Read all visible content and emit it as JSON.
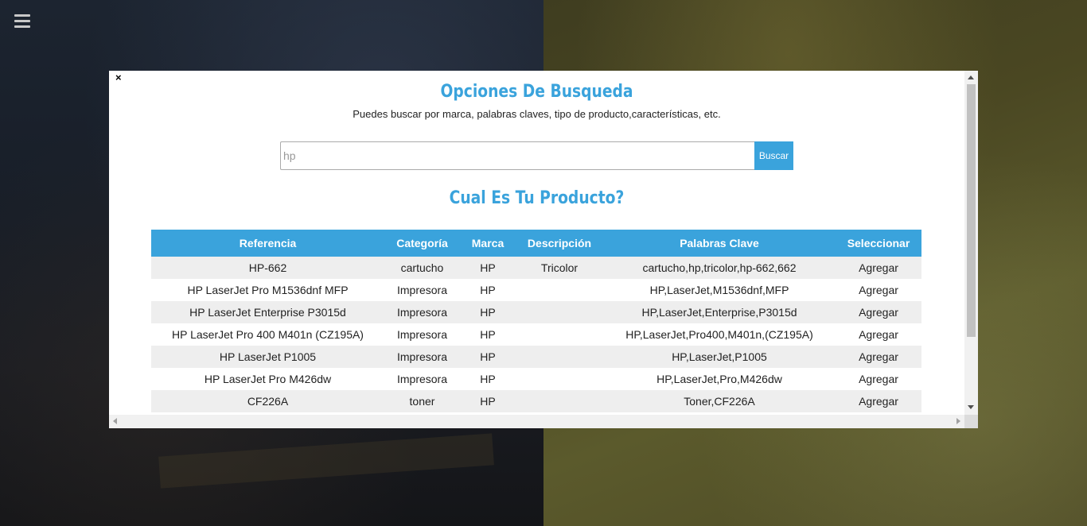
{
  "modal": {
    "close_label": "×",
    "title": "Opciones De Busqueda",
    "subtitle": "Puedes buscar por marca, palabras claves, tipo de producto,características, etc.",
    "search": {
      "value": "hp",
      "button_label": "Buscar"
    },
    "results_title": "Cual Es Tu Producto?",
    "table": {
      "headers": [
        "Referencia",
        "Categoría",
        "Marca",
        "Descripción",
        "Palabras Clave",
        "Seleccionar"
      ],
      "rows": [
        [
          "HP-662",
          "cartucho",
          "HP",
          "Tricolor",
          "cartucho,hp,tricolor,hp-662,662",
          "Agregar"
        ],
        [
          "HP LaserJet Pro M1536dnf MFP",
          "Impresora",
          "HP",
          "",
          "HP,LaserJet,M1536dnf,MFP",
          "Agregar"
        ],
        [
          "HP LaserJet Enterprise P3015d",
          "Impresora",
          "HP",
          "",
          "HP,LaserJet,Enterprise,P3015d",
          "Agregar"
        ],
        [
          "HP LaserJet Pro 400 M401n (CZ195A)",
          "Impresora",
          "HP",
          "",
          "HP,LaserJet,Pro400,M401n,(CZ195A)",
          "Agregar"
        ],
        [
          "HP LaserJet P1005",
          "Impresora",
          "HP",
          "",
          "HP,LaserJet,P1005",
          "Agregar"
        ],
        [
          "HP LaserJet Pro M426dw",
          "Impresora",
          "HP",
          "",
          "HP,LaserJet,Pro,M426dw",
          "Agregar"
        ],
        [
          "CF226A",
          "toner",
          "HP",
          "",
          "Toner,CF226A",
          "Agregar"
        ]
      ]
    }
  },
  "colors": {
    "accent": "#3aa3dc",
    "row_alt": "#eeeeee"
  },
  "icons": {
    "menu": "hamburger-menu-icon",
    "close": "close-icon"
  }
}
